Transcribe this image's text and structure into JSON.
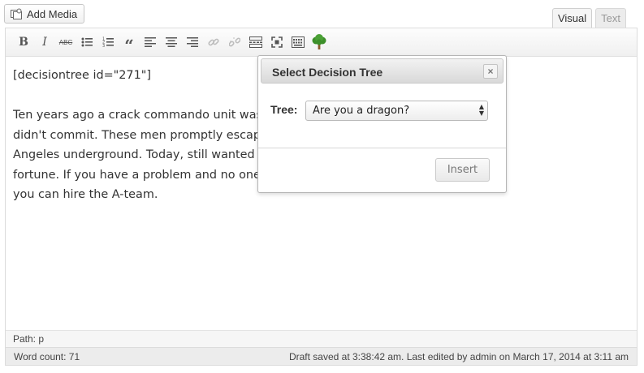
{
  "header": {
    "add_media_label": "Add Media",
    "tabs": [
      {
        "label": "Visual",
        "active": true
      },
      {
        "label": "Text",
        "active": false
      }
    ]
  },
  "toolbar": {
    "buttons": [
      {
        "name": "bold",
        "glyph": "B"
      },
      {
        "name": "italic",
        "glyph": "I"
      },
      {
        "name": "strikethrough",
        "glyph": "ABC"
      },
      {
        "name": "bullet-list",
        "glyph": "list"
      },
      {
        "name": "numbered-list",
        "glyph": "numlist"
      },
      {
        "name": "blockquote",
        "glyph": "“"
      },
      {
        "name": "align-left",
        "glyph": "lines"
      },
      {
        "name": "align-center",
        "glyph": "lines"
      },
      {
        "name": "align-right",
        "glyph": "lines"
      },
      {
        "name": "insert-link",
        "glyph": "link"
      },
      {
        "name": "remove-link",
        "glyph": "unlink"
      },
      {
        "name": "insert-more",
        "glyph": "more"
      },
      {
        "name": "fullscreen",
        "glyph": "fullscreen"
      },
      {
        "name": "kitchen-sink",
        "glyph": "sink"
      },
      {
        "name": "decision-tree",
        "glyph": "tree"
      }
    ]
  },
  "content": {
    "shortcode": "[decisiontree id=\"271\"]",
    "lines": [
      "Ten years ago a crack commando unit was ser",
      "didn't commit. These men promptly escaped",
      "Angeles underground. Today, still wanted by t",
      "fortune. If you have a problem and no one els",
      "you can hire the A-team."
    ]
  },
  "footer": {
    "path": "Path: p",
    "word_count": "Word count: 71",
    "draft_status": "Draft saved at 3:38:42 am. Last edited by admin on March 17, 2014 at 3:11 am"
  },
  "dialog": {
    "title": "Select Decision Tree",
    "close_label": "×",
    "field_label": "Tree:",
    "selected_option": "Are you a dragon?",
    "insert_label": "Insert"
  },
  "colors": {
    "tree_green": "#3d8f2a",
    "trunk_brown": "#8a5a2b"
  }
}
